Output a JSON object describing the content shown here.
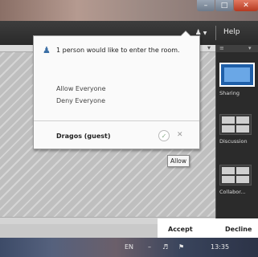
{
  "titlebar": {
    "minimize_glyph": "–",
    "maximize_glyph": "□",
    "close_glyph": "✕"
  },
  "toolbar": {
    "attendees_icon": "user-icon",
    "help_label": "Help"
  },
  "right_panel": {
    "pods": [
      {
        "label": "Sharing"
      },
      {
        "label": "Discussion"
      },
      {
        "label": "Collabor..."
      }
    ]
  },
  "popup": {
    "message": "1 person would like to enter the room.",
    "allow_everyone": "Allow Everyone",
    "deny_everyone": "Deny Everyone",
    "guest_name": "Dragos (guest)",
    "accept_glyph": "✓",
    "deny_glyph": "✕"
  },
  "tooltip": "Allow",
  "action_bar": {
    "accept_label": "Accept",
    "decline_label": "Decline"
  },
  "taskbar": {
    "language": "EN",
    "time": "13:35"
  }
}
